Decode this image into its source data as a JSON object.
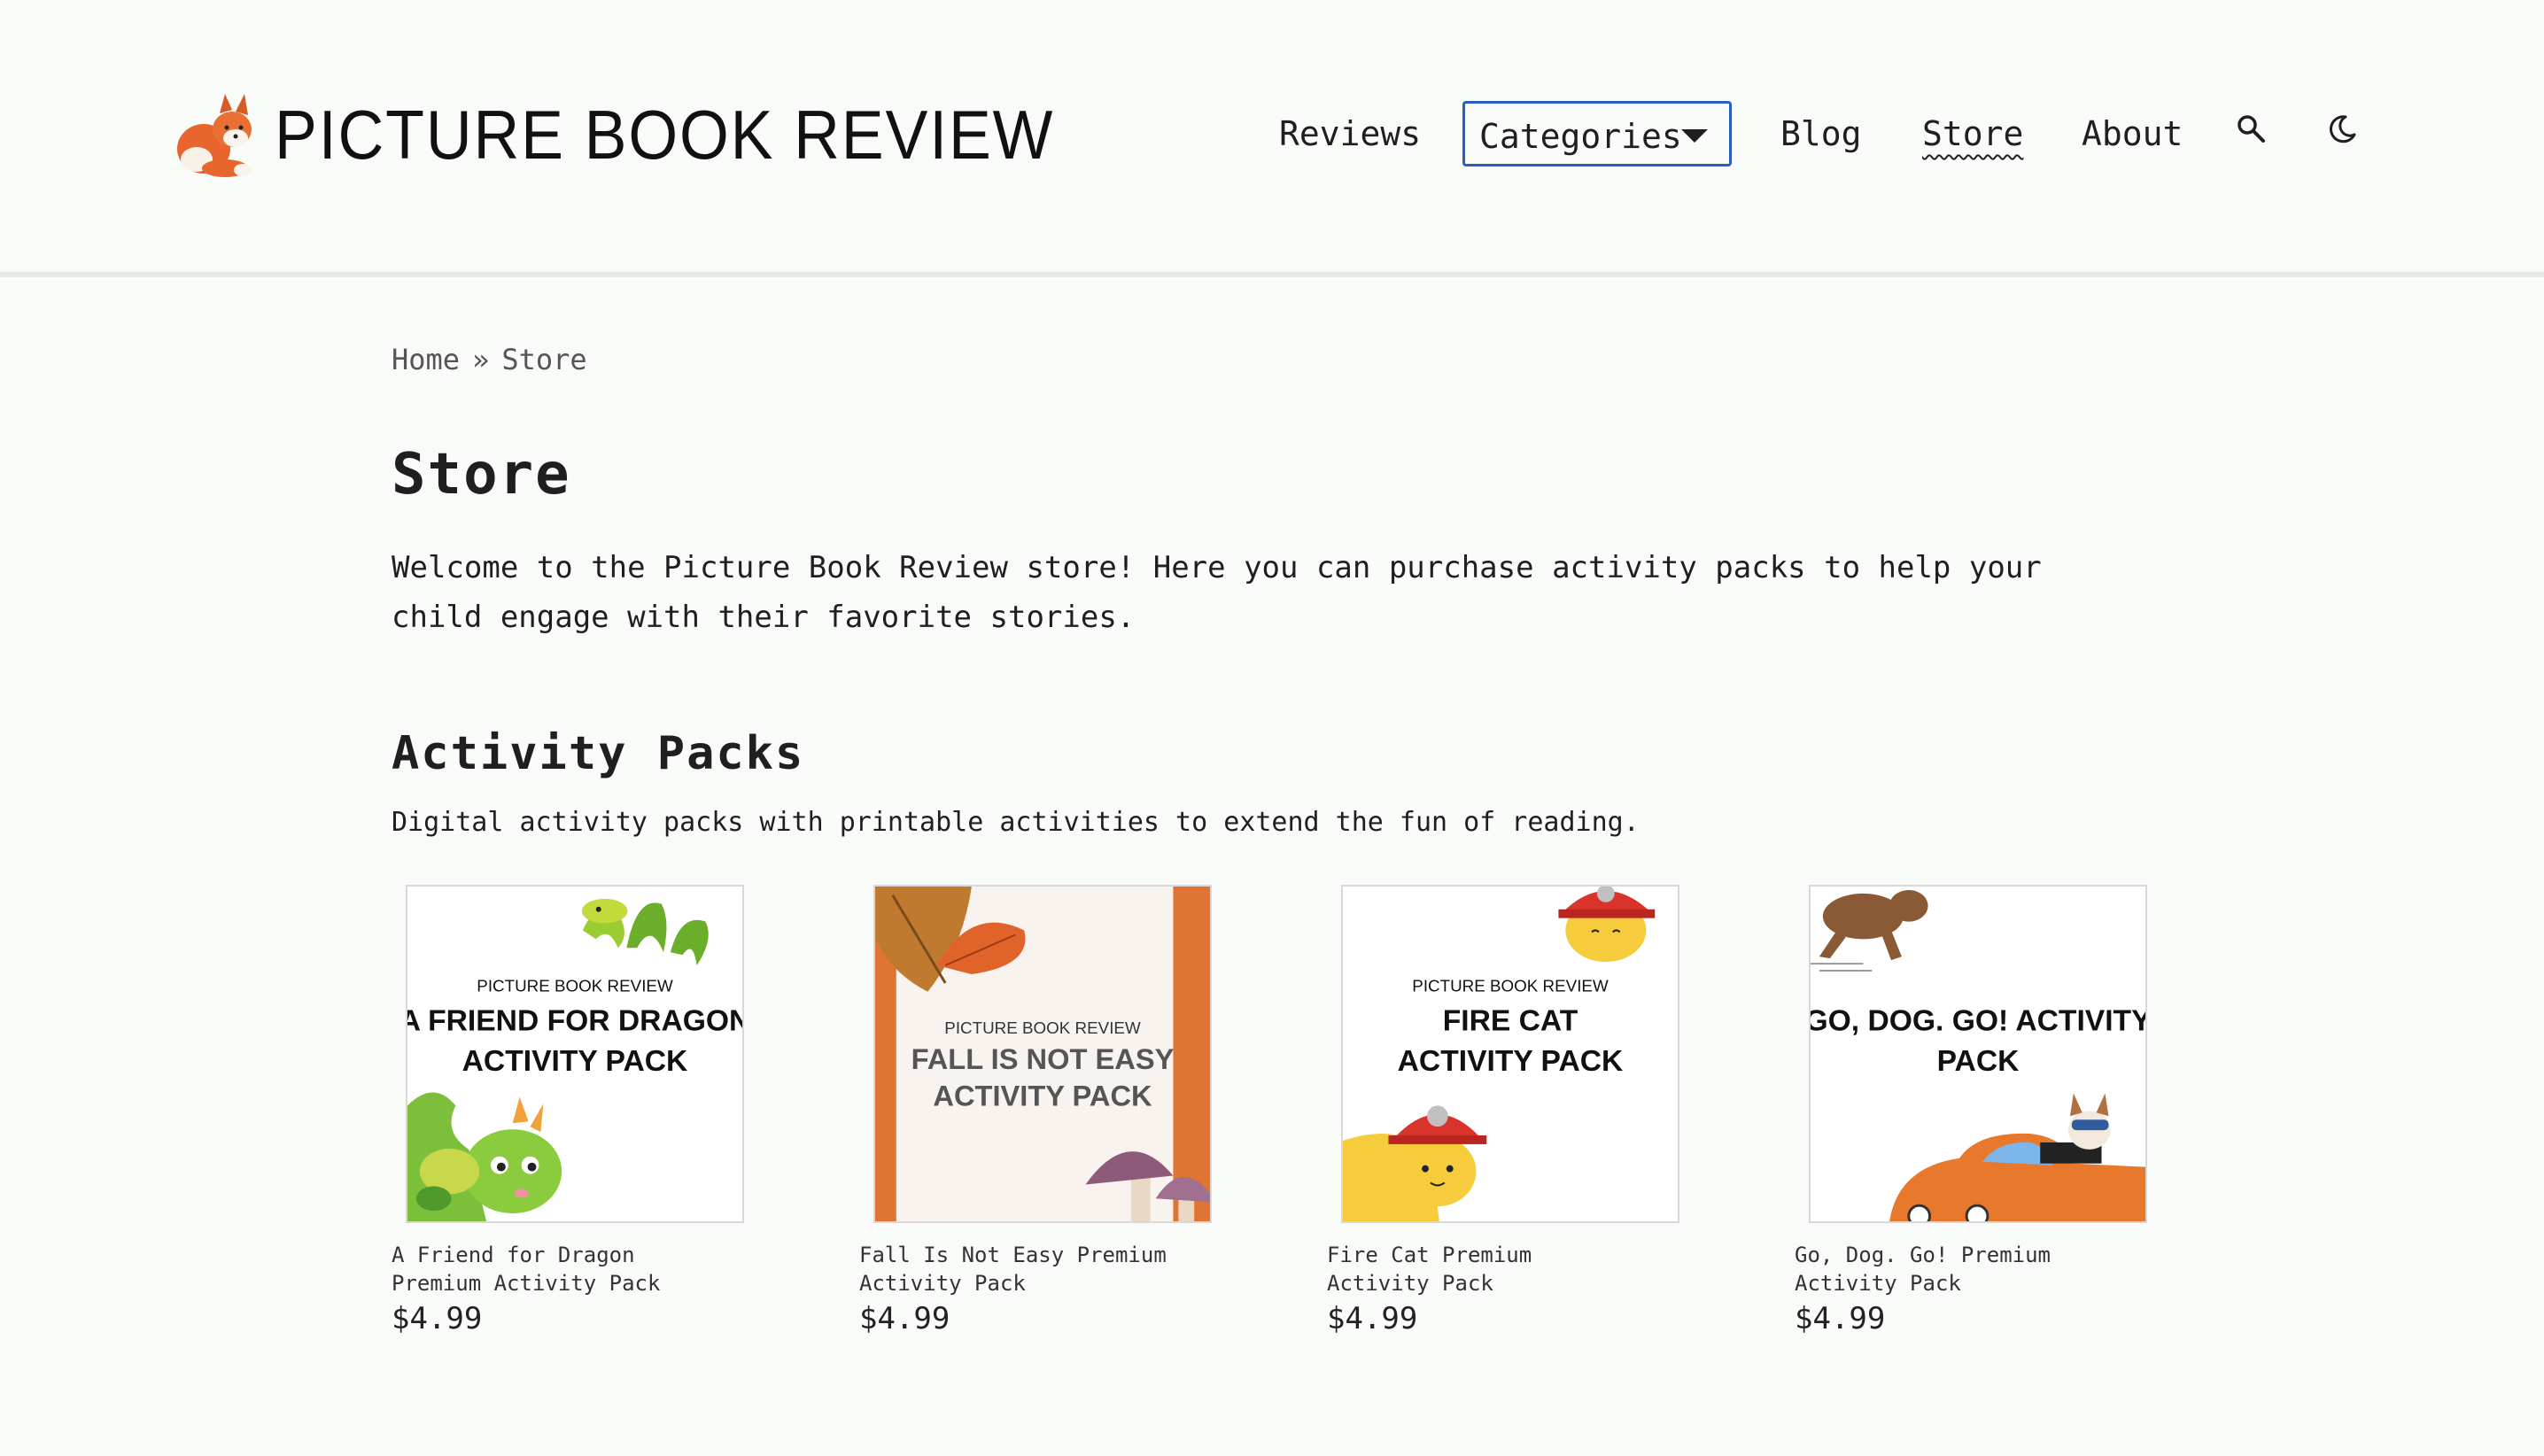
{
  "site": {
    "title": "PICTURE BOOK REVIEW",
    "logo_icon": "fox-icon"
  },
  "nav": {
    "reviews": "Reviews",
    "categories": "Categories",
    "blog": "Blog",
    "store": "Store",
    "about": "About",
    "search_icon": "search-icon",
    "theme_icon": "moon-icon"
  },
  "breadcrumb": {
    "home": "Home",
    "separator": "»",
    "current": "Store"
  },
  "page": {
    "title": "Store",
    "intro": "Welcome to the Picture Book Review store! Here you can purchase activity packs to help your child engage with their favorite stories."
  },
  "section": {
    "title": "Activity Packs",
    "description": "Digital activity packs with printable activities to extend the fun of reading."
  },
  "products": [
    {
      "name": "A Friend for Dragon Premium Activity Pack",
      "price": "$4.99",
      "cover_brand": "PICTURE BOOK REVIEW",
      "cover_line1": "A FRIEND FOR DRAGON",
      "cover_line2": "ACTIVITY PACK"
    },
    {
      "name": "Fall Is Not Easy Premium Activity Pack",
      "price": "$4.99",
      "cover_brand": "PICTURE BOOK REVIEW",
      "cover_line1": "FALL IS NOT EASY",
      "cover_line2": "ACTIVITY PACK"
    },
    {
      "name": "Fire Cat Premium Activity Pack",
      "price": "$4.99",
      "cover_brand": "PICTURE BOOK REVIEW",
      "cover_line1": "FIRE CAT",
      "cover_line2": "ACTIVITY PACK"
    },
    {
      "name": "Go, Dog. Go! Premium Activity Pack",
      "price": "$4.99",
      "cover_line1": "GO, DOG. GO! ACTIVITY",
      "cover_line2": "PACK"
    }
  ],
  "colors": {
    "background": "#f9fbf9",
    "focus_outline": "#2d5ebf",
    "fall_border": "#e07432",
    "car_orange": "#e8782b"
  }
}
